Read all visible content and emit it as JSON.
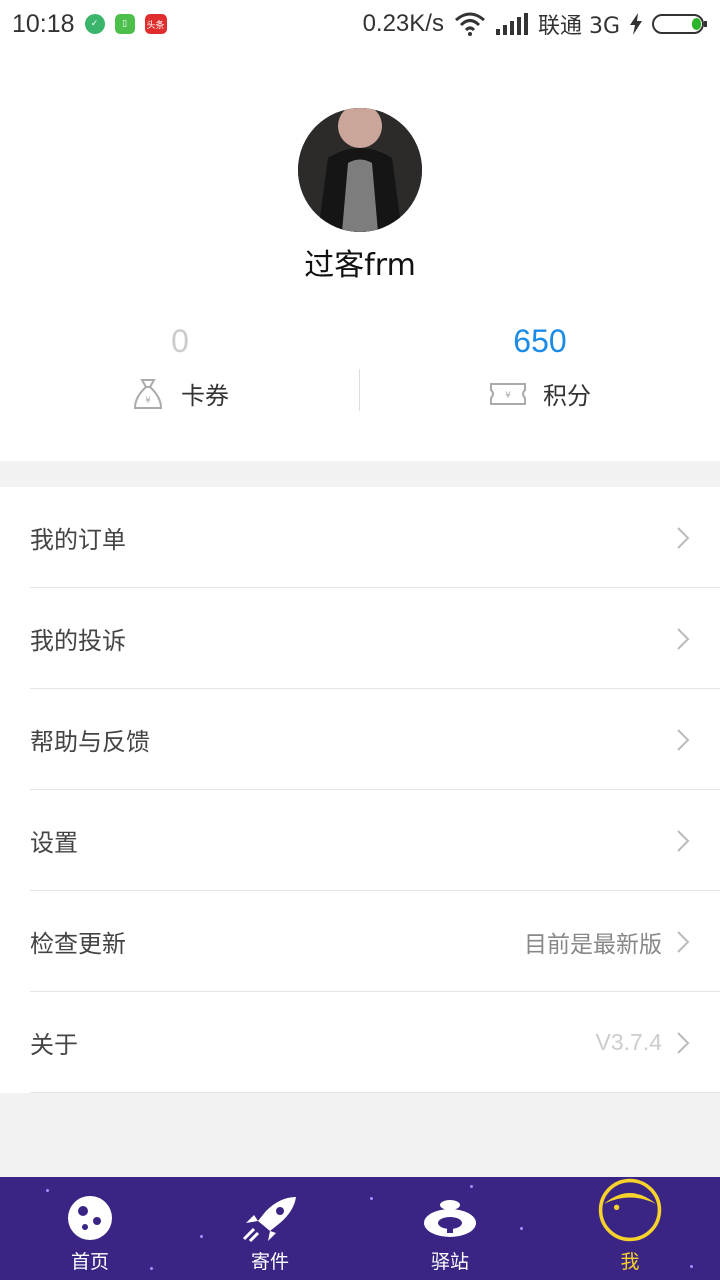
{
  "status_bar": {
    "time": "10:18",
    "notif_badge": "头条",
    "net_speed": "0.23K/s",
    "carrier": "联通 3G"
  },
  "profile": {
    "username": "过客frm",
    "coupons": {
      "value": "0",
      "label": "卡券",
      "icon": "money-bag-icon"
    },
    "points": {
      "value": "650",
      "label": "积分",
      "icon": "ticket-icon"
    }
  },
  "menu": {
    "items": [
      {
        "label": "我的订单"
      },
      {
        "label": "我的投诉"
      },
      {
        "label": "帮助与反馈"
      },
      {
        "label": "设置"
      },
      {
        "label": "检查更新",
        "value": "目前是最新版"
      },
      {
        "label": "关于",
        "value": "V3.7.4"
      }
    ]
  },
  "tabs": [
    {
      "label": "首页",
      "icon": "planet-icon"
    },
    {
      "label": "寄件",
      "icon": "rocket-icon"
    },
    {
      "label": "驿站",
      "icon": "station-icon"
    },
    {
      "label": "我",
      "icon": "moon-face-icon",
      "active": true
    }
  ],
  "colors": {
    "accent_blue": "#1a8be6",
    "tab_bg": "#3a2585",
    "tab_active": "#f6d22b"
  }
}
